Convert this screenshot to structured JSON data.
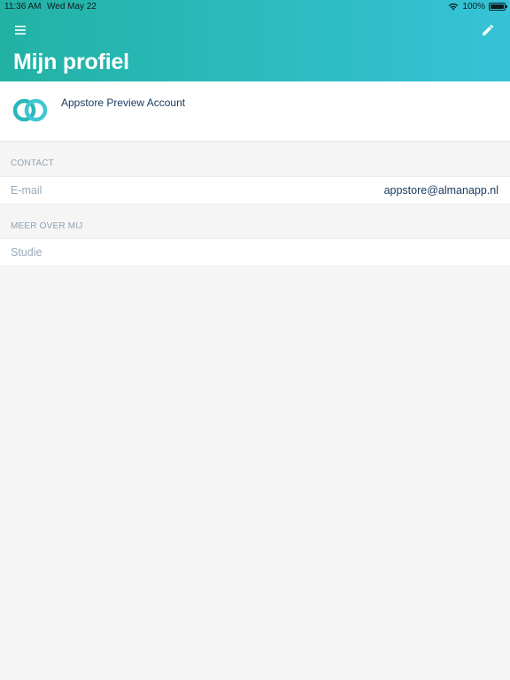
{
  "status_bar": {
    "time": "11:36 AM",
    "date": "Wed May 22",
    "battery": "100%",
    "wifi_icon": "wifi-icon",
    "battery_icon": "battery-icon"
  },
  "header": {
    "title": "Mijn profiel",
    "menu_icon": "hamburger-menu-icon",
    "edit_icon": "pencil-icon",
    "gradient": [
      "#22b2a4",
      "#36c3d7"
    ]
  },
  "profile": {
    "name": "Appstore Preview Account",
    "avatar_icon": "interlocking-rings-logo"
  },
  "sections": {
    "contact": {
      "label": "CONTACT",
      "rows": [
        {
          "label": "E-mail",
          "value": "appstore@almanapp.nl"
        }
      ]
    },
    "about": {
      "label": "MEER OVER MIJ",
      "rows": [
        {
          "label": "Studie",
          "value": ""
        }
      ]
    }
  },
  "colors": {
    "accent": "#2cbcc0",
    "text_primary": "#163a5f",
    "text_secondary": "#9aaab8",
    "background": "#f5f5f5"
  }
}
